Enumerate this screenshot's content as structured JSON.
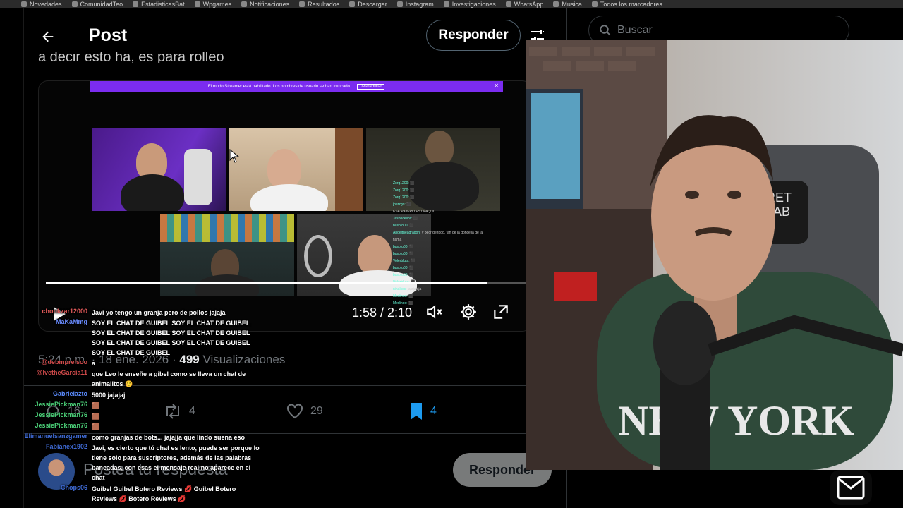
{
  "browser": {
    "bookmarks": [
      "Novedades",
      "ComunidadTeo",
      "EstadisticasBat",
      "Wpgames",
      "Notificaciones",
      "Resultados",
      "Descargar",
      "Instagram",
      "Investigaciones",
      "WhatsApp",
      "Musica",
      "Todos los marcadores"
    ]
  },
  "header": {
    "title": "Post",
    "reply_label": "Responder"
  },
  "post": {
    "text_cut": "a decir esto ha, es para rolleo",
    "video": {
      "banner_text": "El modo Streamer está habilitado. Los nombres de usuario se han truncado.",
      "banner_action": "Deshabilitar",
      "time": "1:58 / 2:10",
      "progress": 0.92
    },
    "meta": {
      "time": "5:24 p.m.",
      "date": "18 ene. 2026",
      "views_count": "499",
      "views_label": "Visualizaciones"
    },
    "actions": {
      "replies": "16",
      "reposts": "4",
      "likes": "29",
      "bookmarks": "4"
    }
  },
  "compose": {
    "placeholder": "Postea tu respuesta",
    "reply_label": "Responder"
  },
  "sidebar": {
    "search_placeholder": "Buscar"
  },
  "mini_chat": [
    {
      "u": "Zorg1200",
      "t": "⬛"
    },
    {
      "u": "Zorg1200",
      "t": "⬛"
    },
    {
      "u": "Zorg1200",
      "t": "⬛"
    },
    {
      "u": "jperzgo",
      "t": "⬛"
    },
    {
      "u": "",
      "t": "ESE PAJERO ESTA AQUI"
    },
    {
      "u": "Jasoncellos",
      "t": "⬛"
    },
    {
      "u": "basoto00",
      "t": "⬛"
    },
    {
      "u": "Angeltheadragon",
      "t": "y peor de todo, fan de la doncella de la"
    },
    {
      "u": "",
      "t": "flama"
    },
    {
      "u": "basoto00",
      "t": "⬛"
    },
    {
      "u": "basoto00",
      "t": "⬛"
    },
    {
      "u": "Volerbluta",
      "t": "⬛"
    },
    {
      "u": "basoto00",
      "t": "⬛"
    },
    {
      "u": "basoto00",
      "t": "⬛"
    },
    {
      "u": "Volerbluta",
      "t": "⬛"
    },
    {
      "u": "nihalsss",
      "t": "jajajajaja"
    },
    {
      "u": "Merlinoo",
      "t": "⬛"
    },
    {
      "u": "Merlinoo",
      "t": "⬛"
    }
  ],
  "stream_chat": [
    {
      "user": "chonkzar12000",
      "user_color": "#e35b5b",
      "text": "Javi yo tengo un granja pero de pollos jajaja"
    },
    {
      "user": "MaKaMmg",
      "user_color": "#6a8cff",
      "text": "SOY EL CHAT DE GUIBEL SOY EL CHAT DE GUIBEL SOY EL CHAT DE GUIBEL SOY EL CHAT DE GUIBEL SOY EL CHAT DE GUIBEL SOY EL CHAT DE GUIBEL SOY EL CHAT DE GUIBEL"
    },
    {
      "user": "@debmprelsoo",
      "user_color": "#d04a4a",
      "text": "a"
    },
    {
      "user": "@IvetheGarcia11",
      "user_color": "#d04a4a",
      "text": "que Leo le enseñe a gibel como se lleva un chat de animalitos 😊"
    },
    {
      "user": "Gabrielazto",
      "user_color": "#5b8cff",
      "text": "5000 jajajaj"
    },
    {
      "user": "JessiePickman76",
      "user_color": "#4cd37a",
      "text": "🟫"
    },
    {
      "user": "JessiePickman76",
      "user_color": "#4cd37a",
      "text": "🟫"
    },
    {
      "user": "JessiePickman76",
      "user_color": "#4cd37a",
      "text": "🟫"
    },
    {
      "user": "Elimanuelsanzgamer",
      "user_color": "#3f6bd6",
      "text": "como granjas de bots... jajajja que lindo suena eso"
    },
    {
      "user": "Fabianex1902",
      "user_color": "#3f6bd6",
      "text": "Javi, es cierto que tú chat es lento, puede ser porque lo tiene solo para suscriptores, además de las palabras baneadas, con esas el mensaje real no aparece en el chat"
    },
    {
      "user": "Chops06",
      "user_color": "#3f6bd6",
      "text": "Guibel Guibel Botero Reviews 💋 Guibel Botero Reviews 💋 Botero Reviews 💋"
    }
  ]
}
